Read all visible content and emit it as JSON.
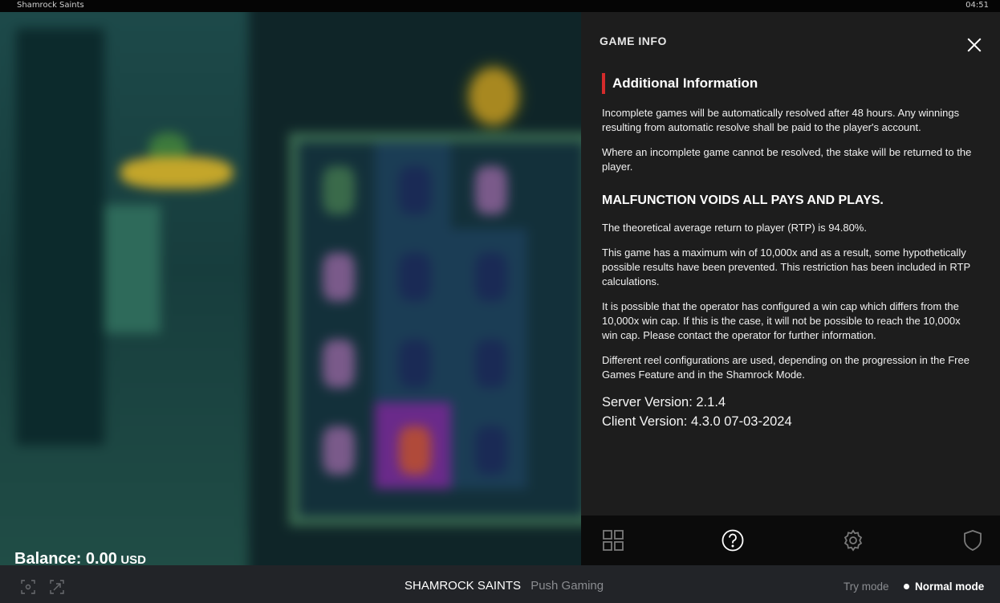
{
  "window": {
    "title": "Shamrock Saints",
    "clock": "04:51"
  },
  "balance": {
    "label": "Balance: 0.00",
    "currency": "USD"
  },
  "panel": {
    "header": "GAME INFO",
    "section_title": "Additional Information",
    "paragraphs_top": [
      "Incomplete games will be automatically resolved after 48 hours. Any winnings resulting from automatic resolve shall be paid to the player's account.",
      "Where an incomplete game cannot be resolved, the stake will be returned to the player."
    ],
    "malfunction_heading": "MALFUNCTION VOIDS ALL PAYS AND PLAYS.",
    "paragraphs_bottom": [
      "The theoretical average return to player (RTP) is 94.80%.",
      "This game has a maximum win of 10,000x and as a result, some hypothetically possible results have been prevented. This restriction has been included in RTP calculations.",
      "It is possible that the operator has configured a win cap which differs from the 10,000x win cap. If this is the case, it will not be possible to reach the 10,000x win cap. Please contact the operator for further information.",
      "Different reel configurations are used, depending on the progression in the Free Games Feature and in the Shamrock Mode."
    ],
    "server_version": "Server Version: 2.1.4",
    "client_version": "Client Version: 4.3.0 07-03-2024",
    "footer_icons": [
      "grid-icon",
      "help-icon",
      "settings-icon",
      "shield-icon"
    ]
  },
  "bottombar": {
    "game_name": "SHAMROCK SAINTS",
    "studio": "Push Gaming",
    "try_mode": "Try mode",
    "normal_mode": "Normal mode",
    "left_icons": [
      "focus-icon",
      "screenshot-icon"
    ]
  },
  "colors": {
    "accent": "#d42b2b",
    "panel_bg": "#1d1d1d",
    "bar_bg": "#222428"
  }
}
